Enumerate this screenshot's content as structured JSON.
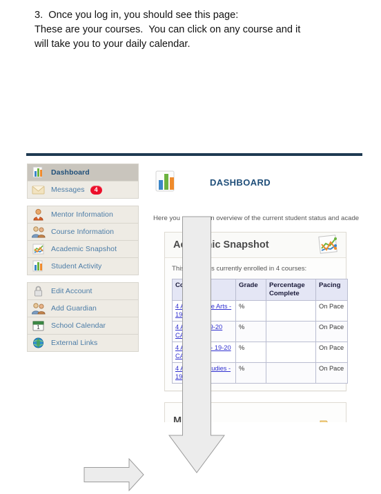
{
  "instructions": {
    "line1": "3.  Once you log in, you should see this page:",
    "line2": "These are your courses.  You can click on any course and it",
    "line3": "will take you to your daily calendar."
  },
  "screenshot": {
    "page_title": "DASHBOARD",
    "intro_text": "Here you can see an overview of the current student status and acade",
    "sidebar": {
      "groups": [
        {
          "items": [
            {
              "label": "Dashboard",
              "icon": "bar-chart-icon",
              "active": true,
              "badge": ""
            },
            {
              "label": "Messages",
              "icon": "envelope-icon",
              "active": false,
              "badge": "4"
            }
          ]
        },
        {
          "items": [
            {
              "label": "Mentor Information",
              "icon": "person-icon",
              "active": false,
              "badge": ""
            },
            {
              "label": "Course Information",
              "icon": "two-people-icon",
              "active": false,
              "badge": ""
            },
            {
              "label": "Academic Snapshot",
              "icon": "line-chart-icon",
              "active": false,
              "badge": ""
            },
            {
              "label": "Student Activity",
              "icon": "bar-chart-icon",
              "active": false,
              "badge": ""
            }
          ]
        },
        {
          "items": [
            {
              "label": "Edit Account",
              "icon": "padlock-icon",
              "active": false,
              "badge": ""
            },
            {
              "label": "Add Guardian",
              "icon": "two-people-icon",
              "active": false,
              "badge": ""
            },
            {
              "label": "School Calendar",
              "icon": "calendar-icon",
              "active": false,
              "badge": ""
            },
            {
              "label": "External Links",
              "icon": "globe-icon",
              "active": false,
              "badge": ""
            }
          ]
        }
      ]
    },
    "snapshot_card": {
      "title": "Academic Snapshot",
      "icon": "line-chart-icon",
      "enrolled_text": "This student is currently enrolled in 4 courses:",
      "table": {
        "headers": [
          "Course",
          "Grade",
          "Percentage Complete",
          "Pacing"
        ],
        "rows": [
          {
            "course": "4 A Language Arts - 19-20 CA",
            "grade": "%",
            "percentage_complete": "",
            "pacing": "On Pace"
          },
          {
            "course": "4 A Math - 19-20 CA",
            "grade": "%",
            "percentage_complete": "",
            "pacing": "On Pace"
          },
          {
            "course": "4 A Science - 19-20 CA",
            "grade": "%",
            "percentage_complete": "",
            "pacing": "On Pace"
          },
          {
            "course": "4 A Social Studies - 19-20 CA",
            "grade": "%",
            "percentage_complete": "",
            "pacing": "On Pace"
          }
        ]
      }
    },
    "second_card": {
      "title": "M",
      "icon": "folder-icon"
    }
  },
  "annotations": {
    "down_arrow": "down-arrow-annotation",
    "right_arrow": "right-arrow-annotation"
  },
  "colors": {
    "rule": "#1f3a52",
    "title": "#1f4e79",
    "nav_link": "#4a7ba6",
    "badge": "#ec0f2a",
    "table_header": "#e4e6f5",
    "link": "#2f2fd0",
    "arrow_fill": "#ececec"
  }
}
